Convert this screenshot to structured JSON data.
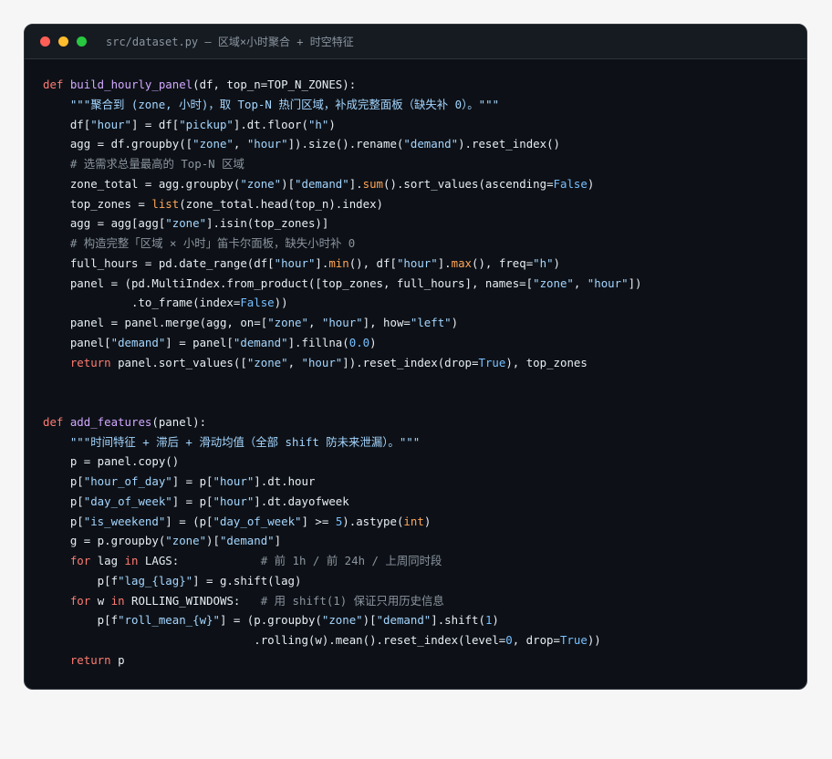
{
  "window": {
    "title": "src/dataset.py — 区域×小时聚合 + 时空特征",
    "traffic_lights": [
      {
        "name": "close-dot",
        "color": "#ff5f57"
      },
      {
        "name": "minimize-dot",
        "color": "#febc2e"
      },
      {
        "name": "maximize-dot",
        "color": "#28c840"
      }
    ]
  },
  "colors": {
    "background": "#0d1117",
    "keyword": "#ff7b72",
    "function": "#d2a8ff",
    "string": "#a5d6ff",
    "number": "#79c0ff",
    "comment": "#8b949e",
    "builtin": "#ffa657",
    "text": "#e6edf3"
  },
  "code_lines": [
    [
      [
        "kw",
        "def "
      ],
      [
        "fn",
        "build_hourly_panel"
      ],
      [
        "tx",
        "(df, top_n=TOP_N_ZONES):"
      ]
    ],
    [
      [
        "tx",
        "    "
      ],
      [
        "str",
        "\"\"\"聚合到 (zone, 小时)，取 Top-N 热门区域，补成完整面板（缺失补 0）。\"\"\""
      ]
    ],
    [
      [
        "tx",
        "    df["
      ],
      [
        "str",
        "\"hour\""
      ],
      [
        "tx",
        "] = df["
      ],
      [
        "str",
        "\"pickup\""
      ],
      [
        "tx",
        "].dt.floor("
      ],
      [
        "str",
        "\"h\""
      ],
      [
        "tx",
        ")"
      ]
    ],
    [
      [
        "tx",
        "    agg = df.groupby(["
      ],
      [
        "str",
        "\"zone\""
      ],
      [
        "tx",
        ", "
      ],
      [
        "str",
        "\"hour\""
      ],
      [
        "tx",
        "]).size().rename("
      ],
      [
        "str",
        "\"demand\""
      ],
      [
        "tx",
        ").reset_index()"
      ]
    ],
    [
      [
        "tx",
        "    "
      ],
      [
        "cm",
        "# 选需求总量最高的 Top-N 区域"
      ]
    ],
    [
      [
        "tx",
        "    zone_total = agg.groupby("
      ],
      [
        "str",
        "\"zone\""
      ],
      [
        "tx",
        ")["
      ],
      [
        "str",
        "\"demand\""
      ],
      [
        "tx",
        "]."
      ],
      [
        "bi",
        "sum"
      ],
      [
        "tx",
        "().sort_values(ascending="
      ],
      [
        "num",
        "False"
      ],
      [
        "tx",
        ")"
      ]
    ],
    [
      [
        "tx",
        "    top_zones = "
      ],
      [
        "bi",
        "list"
      ],
      [
        "tx",
        "(zone_total.head(top_n).index)"
      ]
    ],
    [
      [
        "tx",
        "    agg = agg[agg["
      ],
      [
        "str",
        "\"zone\""
      ],
      [
        "tx",
        "].isin(top_zones)]"
      ]
    ],
    [
      [
        "tx",
        "    "
      ],
      [
        "cm",
        "# 构造完整「区域 × 小时」笛卡尔面板，缺失小时补 0"
      ]
    ],
    [
      [
        "tx",
        "    full_hours = pd.date_range(df["
      ],
      [
        "str",
        "\"hour\""
      ],
      [
        "tx",
        "]."
      ],
      [
        "bi",
        "min"
      ],
      [
        "tx",
        "(), df["
      ],
      [
        "str",
        "\"hour\""
      ],
      [
        "tx",
        "]."
      ],
      [
        "bi",
        "max"
      ],
      [
        "tx",
        "(), freq="
      ],
      [
        "str",
        "\"h\""
      ],
      [
        "tx",
        ")"
      ]
    ],
    [
      [
        "tx",
        "    panel = (pd.MultiIndex.from_product([top_zones, full_hours], names=["
      ],
      [
        "str",
        "\"zone\""
      ],
      [
        "tx",
        ", "
      ],
      [
        "str",
        "\"hour\""
      ],
      [
        "tx",
        "])"
      ]
    ],
    [
      [
        "tx",
        "             .to_frame(index="
      ],
      [
        "num",
        "False"
      ],
      [
        "tx",
        "))"
      ]
    ],
    [
      [
        "tx",
        "    panel = panel.merge(agg, on=["
      ],
      [
        "str",
        "\"zone\""
      ],
      [
        "tx",
        ", "
      ],
      [
        "str",
        "\"hour\""
      ],
      [
        "tx",
        "], how="
      ],
      [
        "str",
        "\"left\""
      ],
      [
        "tx",
        ")"
      ]
    ],
    [
      [
        "tx",
        "    panel["
      ],
      [
        "str",
        "\"demand\""
      ],
      [
        "tx",
        "] = panel["
      ],
      [
        "str",
        "\"demand\""
      ],
      [
        "tx",
        "].fillna("
      ],
      [
        "num",
        "0.0"
      ],
      [
        "tx",
        ")"
      ]
    ],
    [
      [
        "tx",
        "    "
      ],
      [
        "kw",
        "return"
      ],
      [
        "tx",
        " panel.sort_values(["
      ],
      [
        "str",
        "\"zone\""
      ],
      [
        "tx",
        ", "
      ],
      [
        "str",
        "\"hour\""
      ],
      [
        "tx",
        "]).reset_index(drop="
      ],
      [
        "num",
        "True"
      ],
      [
        "tx",
        "), top_zones"
      ]
    ],
    [],
    [],
    [
      [
        "kw",
        "def "
      ],
      [
        "fn",
        "add_features"
      ],
      [
        "tx",
        "(panel):"
      ]
    ],
    [
      [
        "tx",
        "    "
      ],
      [
        "str",
        "\"\"\"时间特征 + 滞后 + 滑动均值（全部 shift 防未来泄漏）。\"\"\""
      ]
    ],
    [
      [
        "tx",
        "    p = panel.copy()"
      ]
    ],
    [
      [
        "tx",
        "    p["
      ],
      [
        "str",
        "\"hour_of_day\""
      ],
      [
        "tx",
        "] = p["
      ],
      [
        "str",
        "\"hour\""
      ],
      [
        "tx",
        "].dt.hour"
      ]
    ],
    [
      [
        "tx",
        "    p["
      ],
      [
        "str",
        "\"day_of_week\""
      ],
      [
        "tx",
        "] = p["
      ],
      [
        "str",
        "\"hour\""
      ],
      [
        "tx",
        "].dt.dayofweek"
      ]
    ],
    [
      [
        "tx",
        "    p["
      ],
      [
        "str",
        "\"is_weekend\""
      ],
      [
        "tx",
        "] = (p["
      ],
      [
        "str",
        "\"day_of_week\""
      ],
      [
        "tx",
        "] >= "
      ],
      [
        "num",
        "5"
      ],
      [
        "tx",
        ").astype("
      ],
      [
        "bi",
        "int"
      ],
      [
        "tx",
        ")"
      ]
    ],
    [
      [
        "tx",
        "    g = p.groupby("
      ],
      [
        "str",
        "\"zone\""
      ],
      [
        "tx",
        ")["
      ],
      [
        "str",
        "\"demand\""
      ],
      [
        "tx",
        "]"
      ]
    ],
    [
      [
        "tx",
        "    "
      ],
      [
        "kw",
        "for"
      ],
      [
        "tx",
        " lag "
      ],
      [
        "kw",
        "in"
      ],
      [
        "tx",
        " LAGS:            "
      ],
      [
        "cm",
        "# 前 1h / 前 24h / 上周同时段"
      ]
    ],
    [
      [
        "tx",
        "        p[f"
      ],
      [
        "str",
        "\"lag_{lag}\""
      ],
      [
        "tx",
        "] = g.shift(lag)"
      ]
    ],
    [
      [
        "tx",
        "    "
      ],
      [
        "kw",
        "for"
      ],
      [
        "tx",
        " w "
      ],
      [
        "kw",
        "in"
      ],
      [
        "tx",
        " ROLLING_WINDOWS:   "
      ],
      [
        "cm",
        "# 用 shift(1) 保证只用历史信息"
      ]
    ],
    [
      [
        "tx",
        "        p[f"
      ],
      [
        "str",
        "\"roll_mean_{w}\""
      ],
      [
        "tx",
        "] = (p.groupby("
      ],
      [
        "str",
        "\"zone\""
      ],
      [
        "tx",
        ")["
      ],
      [
        "str",
        "\"demand\""
      ],
      [
        "tx",
        "].shift("
      ],
      [
        "num",
        "1"
      ],
      [
        "tx",
        ")"
      ]
    ],
    [
      [
        "tx",
        "                               .rolling(w).mean().reset_index(level="
      ],
      [
        "num",
        "0"
      ],
      [
        "tx",
        ", drop="
      ],
      [
        "num",
        "True"
      ],
      [
        "tx",
        "))"
      ]
    ],
    [
      [
        "tx",
        "    "
      ],
      [
        "kw",
        "return"
      ],
      [
        "tx",
        " p"
      ]
    ]
  ]
}
